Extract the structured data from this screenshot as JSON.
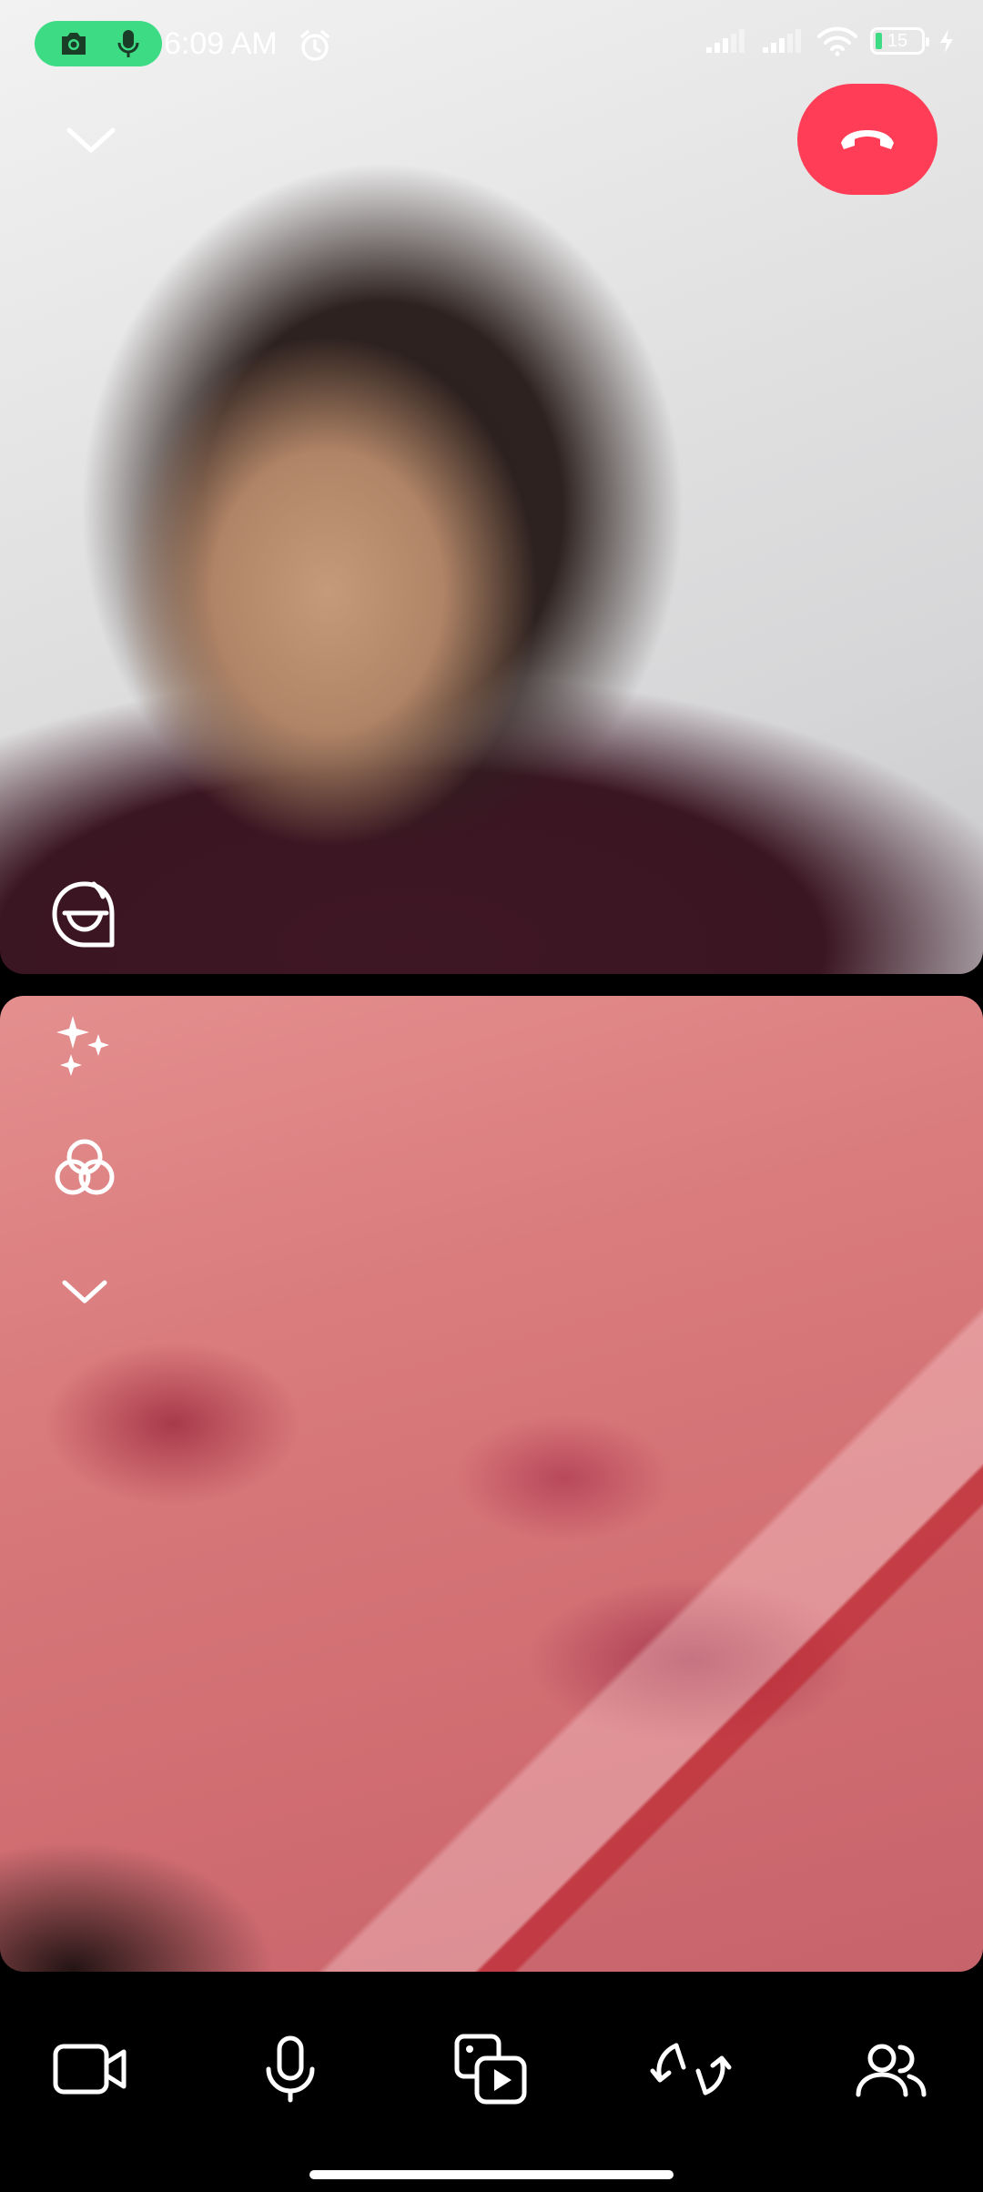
{
  "status_bar": {
    "time": "6:09 AM",
    "battery_level": "15",
    "battery_fraction": 0.15,
    "icons": [
      "camera-in-use-icon",
      "mic-in-use-icon",
      "alarm-icon",
      "cellular-signal-icon",
      "cellular-signal-icon",
      "wifi-icon",
      "battery-icon",
      "charging-icon"
    ]
  },
  "call": {
    "top_controls": [
      "chevron-down-icon",
      "end-call-icon"
    ],
    "remote_tools": [
      "sticker-icon"
    ],
    "local_tools": [
      "sparkle-effects-icon",
      "lens-filter-icon",
      "chevron-down-icon"
    ]
  },
  "bottom_bar": {
    "buttons": [
      "video-camera-icon",
      "microphone-icon",
      "share-media-icon",
      "flip-camera-icon",
      "participants-icon"
    ]
  },
  "colors": {
    "recording_pill": "#3ddc84",
    "end_call": "#ff3d56",
    "background": "#000000"
  }
}
